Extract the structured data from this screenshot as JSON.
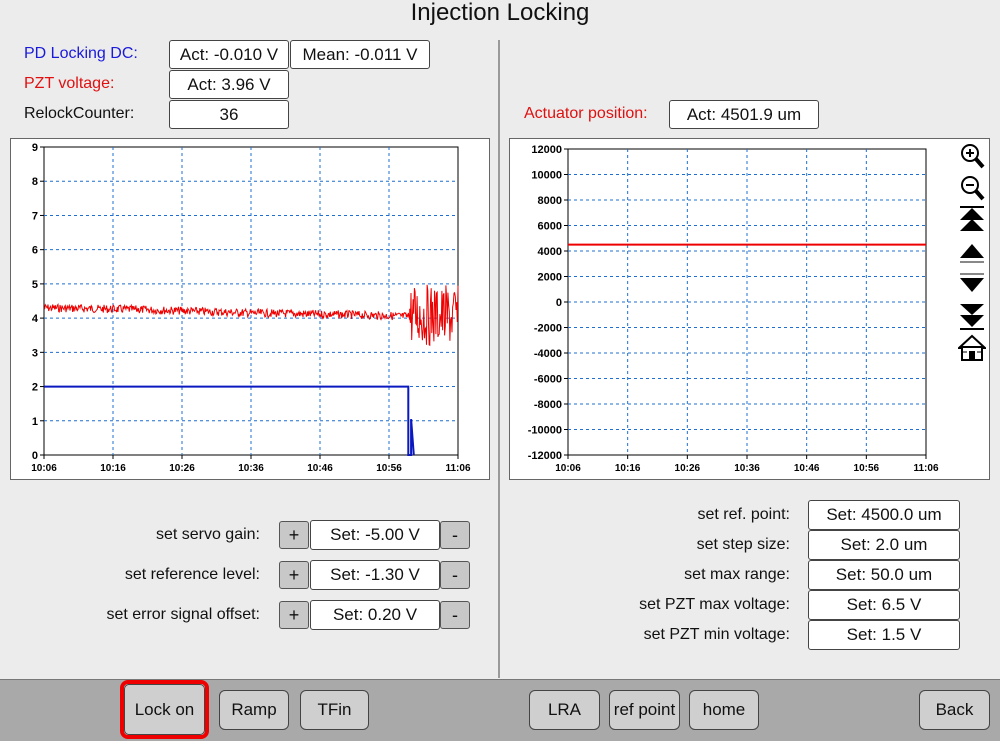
{
  "title": "Injection Locking",
  "left_status": {
    "pd_label": "PD Locking DC:",
    "pd_act": "Act: -0.010 V",
    "pd_mean": "Mean: -0.011 V",
    "pzt_label": "PZT voltage:",
    "pzt_act": "Act: 3.96 V",
    "relock_label": "RelockCounter:",
    "relock_value": "36"
  },
  "right_status": {
    "actuator_label": "Actuator position:",
    "actuator_act": "Act: 4501.9 um"
  },
  "colors": {
    "blue_label": "#1a1adb",
    "red_label": "#e01010",
    "pzt_trace": "#ee0000",
    "pd_trace": "#0a18c0",
    "grid": "#1f6fd0",
    "active_button": "#ee0000"
  },
  "chart_data": [
    {
      "type": "line",
      "title": "",
      "xlabel": "",
      "ylabel": "",
      "x_ticks": [
        "10:06",
        "10:16",
        "10:26",
        "10:36",
        "10:46",
        "10:56",
        "11:06"
      ],
      "y_ticks": [
        "0",
        "1",
        "2",
        "3",
        "4",
        "5",
        "6",
        "7",
        "8",
        "9"
      ],
      "ylim": [
        0,
        9
      ],
      "grid": true,
      "series": [
        {
          "color": "#ee0000",
          "x": [
            "10:06",
            "10:20",
            "10:36",
            "10:50",
            "10:59",
            "10:59",
            "11:06"
          ],
          "values": [
            4.3,
            4.25,
            4.15,
            4.1,
            4.05,
            4.1,
            4.05
          ],
          "noise": [
            0.12,
            0.12,
            0.12,
            0.12,
            0.12,
            0.9,
            0.9
          ]
        },
        {
          "color": "#0a18c0",
          "x": [
            "10:06",
            "10:58.8",
            "10:58.8",
            "10:59.2",
            "10:59.2",
            "10:59.6"
          ],
          "values": [
            2.0,
            2.0,
            0.0,
            0.0,
            1.05,
            0.0
          ]
        }
      ]
    },
    {
      "type": "line",
      "title": "",
      "xlabel": "",
      "ylabel": "",
      "x_ticks": [
        "10:06",
        "10:16",
        "10:26",
        "10:36",
        "10:46",
        "10:56",
        "11:06"
      ],
      "y_ticks": [
        "-12000",
        "-10000",
        "-8000",
        "-6000",
        "-4000",
        "-2000",
        "0",
        "2000",
        "4000",
        "6000",
        "8000",
        "10000",
        "12000"
      ],
      "ylim": [
        -12000,
        12000
      ],
      "grid": true,
      "series": [
        {
          "color": "#ee0000",
          "x": [
            "10:06",
            "11:06"
          ],
          "values": [
            4501.9,
            4501.9
          ]
        }
      ]
    }
  ],
  "plot_tools": [
    {
      "name": "zoom-in-icon"
    },
    {
      "name": "zoom-out-icon"
    },
    {
      "name": "page-up-icon"
    },
    {
      "name": "arrow-up-icon"
    },
    {
      "name": "arrow-down-icon"
    },
    {
      "name": "page-down-icon"
    },
    {
      "name": "home-icon"
    }
  ],
  "left_controls": {
    "servo_gain_label": "set servo gain:",
    "servo_gain_value": "Set: -5.00 V",
    "reference_level_label": "set reference level:",
    "reference_level_value": "Set: -1.30  V",
    "error_offset_label": "set error signal offset:",
    "error_offset_value": "Set: 0.20 V",
    "plus": "+",
    "minus": "-"
  },
  "right_controls": {
    "ref_point_label": "set ref. point:",
    "ref_point_value": "Set: 4500.0 um",
    "step_size_label": "set step size:",
    "step_size_value": "Set: 2.0 um",
    "max_range_label": "set max range:",
    "max_range_value": "Set: 50.0 um",
    "pzt_max_label": "set PZT max voltage:",
    "pzt_max_value": "Set: 6.5 V",
    "pzt_min_label": "set PZT min voltage:",
    "pzt_min_value": "Set: 1.5 V"
  },
  "bottom_buttons": {
    "lock_on": "Lock on",
    "ramp": "Ramp",
    "tfin": "TFin",
    "lra": "LRA",
    "ref_point": "ref point",
    "home": "home",
    "back": "Back"
  }
}
